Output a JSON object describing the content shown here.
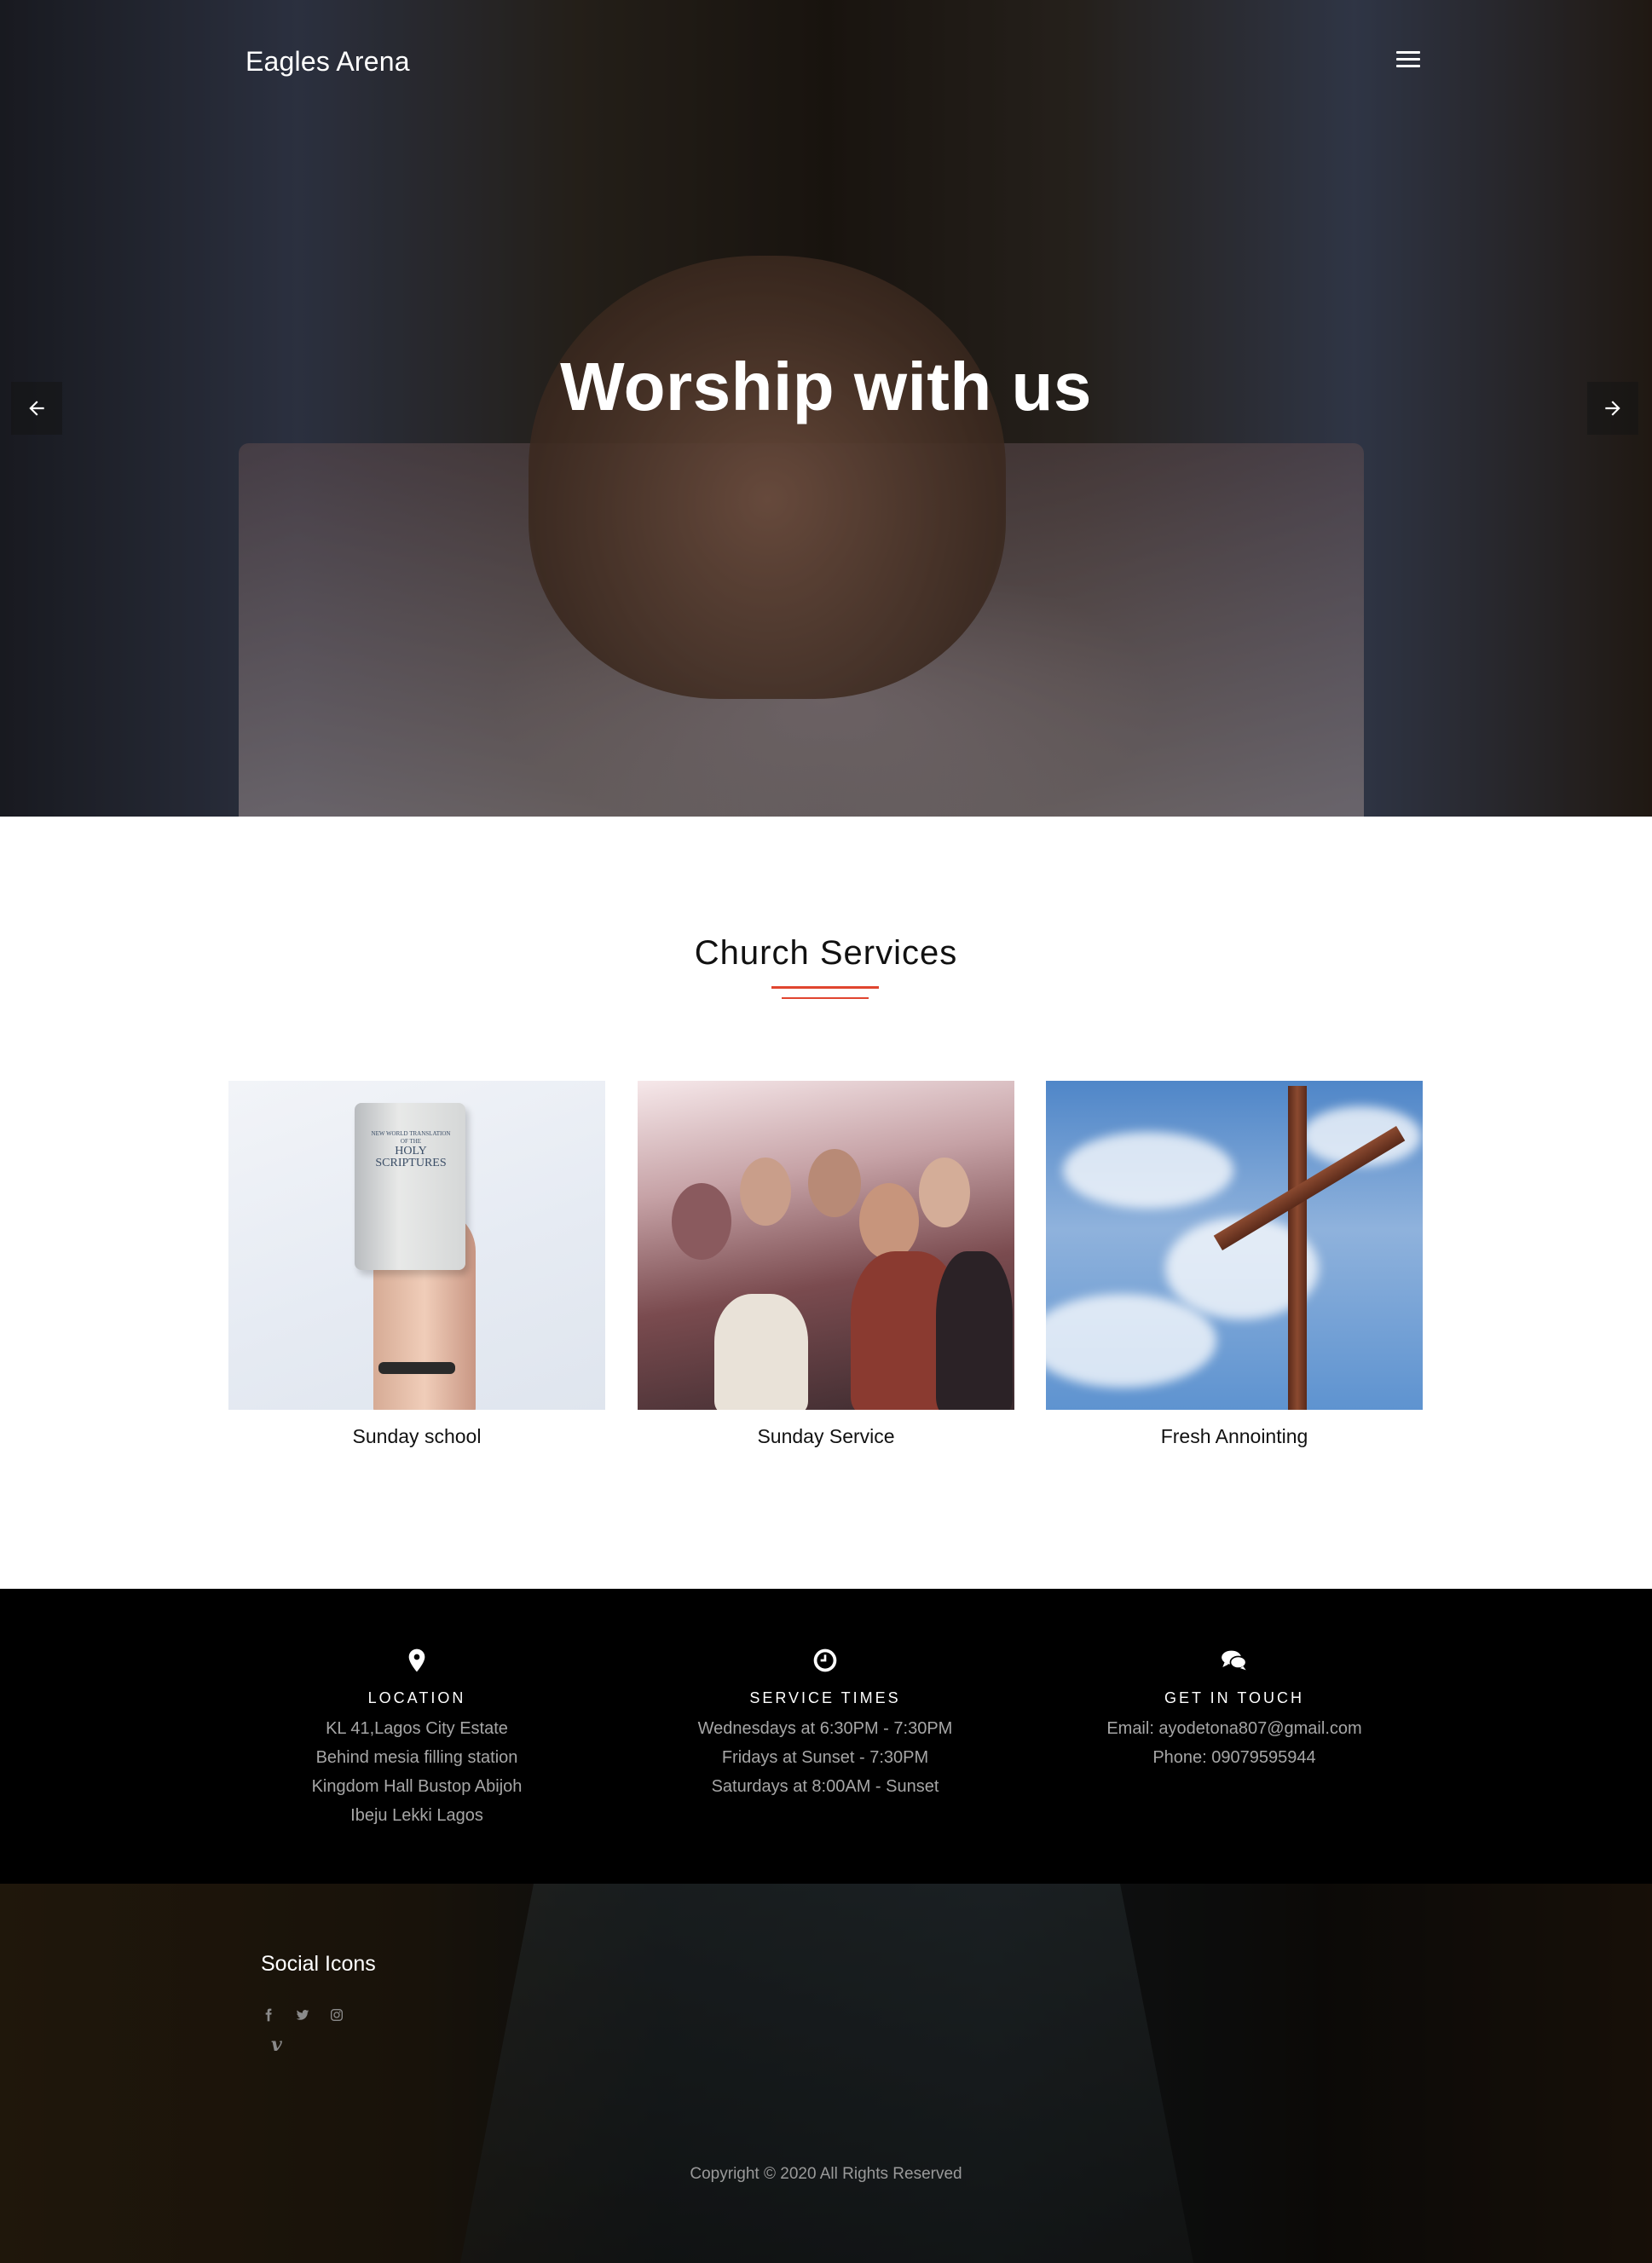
{
  "header": {
    "brand": "Eagles Arena"
  },
  "hero": {
    "title": "Worship with us"
  },
  "services": {
    "title": "Church Services",
    "items": [
      {
        "caption": "Sunday school"
      },
      {
        "caption": "Sunday Service"
      },
      {
        "caption": "Fresh Annointing"
      }
    ],
    "bible_cover_text": [
      "NEW WORLD TRANSLATION",
      "OF THE",
      "HOLY",
      "SCRIPTURES"
    ]
  },
  "info": {
    "location": {
      "heading": "LOCATION",
      "lines": [
        "KL 41,Lagos City Estate",
        "Behind mesia filling station",
        "Kingdom Hall Bustop Abijoh",
        "Ibeju Lekki Lagos"
      ]
    },
    "service_times": {
      "heading": "SERVICE TIMES",
      "lines": [
        "Wednesdays at 6:30PM - 7:30PM",
        "Fridays at Sunset - 7:30PM",
        "Saturdays at 8:00AM - Sunset"
      ]
    },
    "contact": {
      "heading": "GET IN TOUCH",
      "lines": [
        "Email: ayodetona807@gmail.com",
        "Phone: 09079595944"
      ]
    }
  },
  "footer": {
    "social_title": "Social Icons",
    "social_icons": [
      "facebook-icon",
      "twitter-icon",
      "instagram-icon",
      "vimeo-icon"
    ],
    "vimeo_glyph": "v",
    "copyright": "Copyright © 2020 All Rights Reserved"
  },
  "colors": {
    "accent": "#e0452f",
    "info_bar_bg": "#000000",
    "muted_text": "#a6a6a6"
  }
}
